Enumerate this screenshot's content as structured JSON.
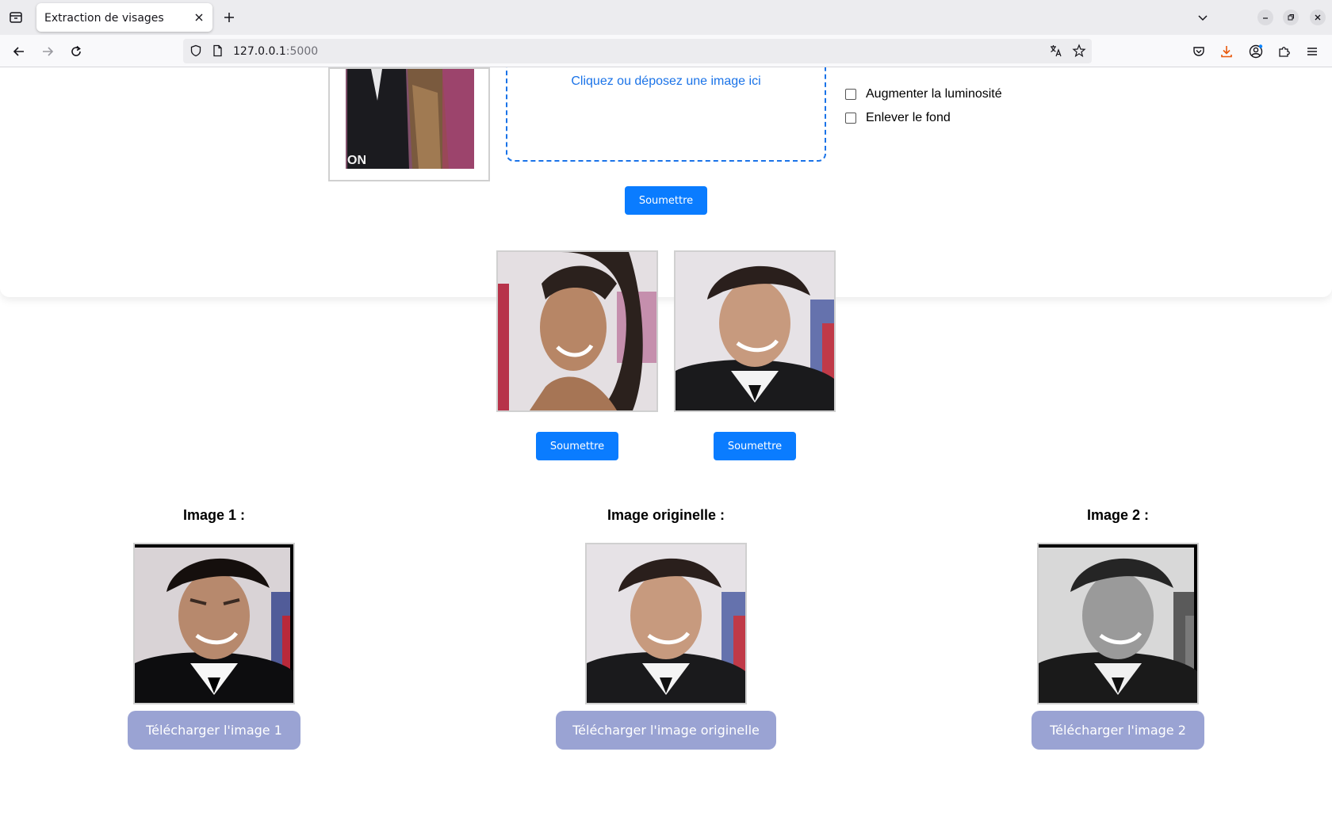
{
  "browser": {
    "tab_title": "Extraction de visages",
    "url_host": "127.0.0.1",
    "url_port": ":5000"
  },
  "form": {
    "dropzone_text": "Cliquez ou déposez une image ici",
    "options": [
      {
        "label": "Augmenter la luminosité",
        "checked": false
      },
      {
        "label": "Enlever le fond",
        "checked": false
      }
    ],
    "submit_label": "Soumettre"
  },
  "faces": [
    {
      "submit_label": "Soumettre"
    },
    {
      "submit_label": "Soumettre"
    }
  ],
  "results": [
    {
      "title": "Image 1 :",
      "download_label": "Télécharger l'image 1"
    },
    {
      "title": "Image originelle :",
      "download_label": "Télécharger l'image originelle"
    },
    {
      "title": "Image 2 :",
      "download_label": "Télécharger l'image 2"
    }
  ],
  "colors": {
    "primary_button": "#0a7cff",
    "download_button": "#9aa3d3",
    "dropzone_border": "#1a73e8"
  }
}
